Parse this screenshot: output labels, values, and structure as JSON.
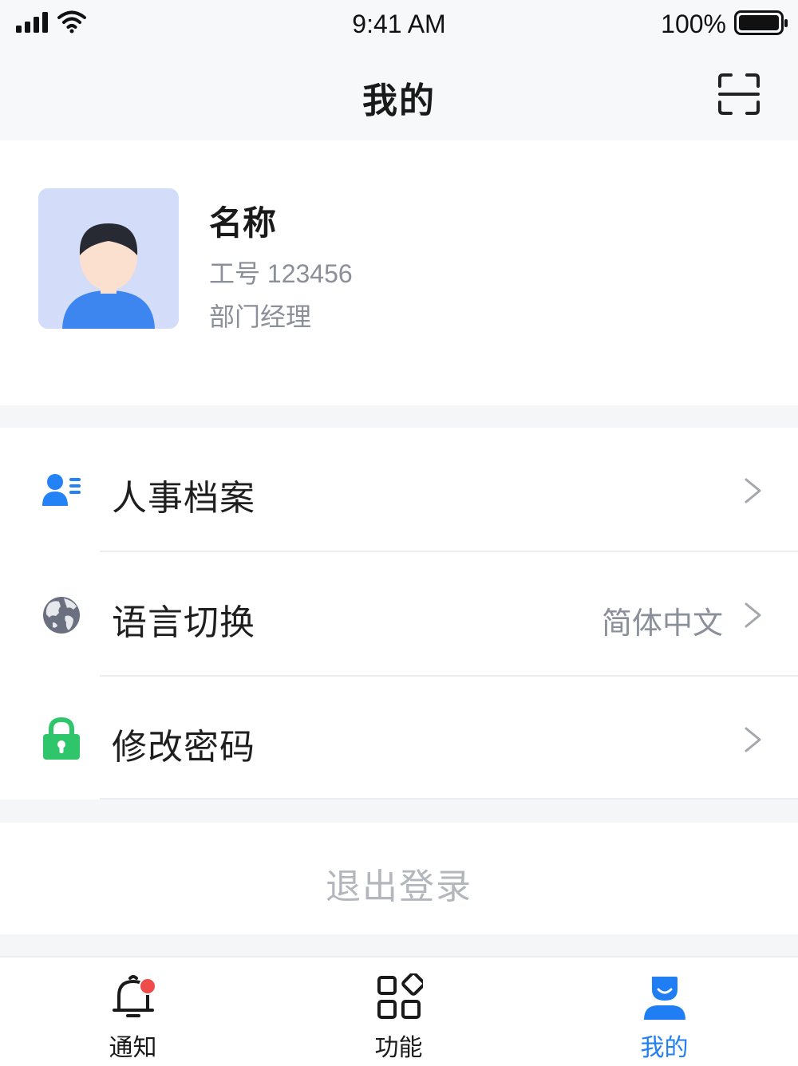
{
  "status_bar": {
    "time": "9:41 AM",
    "battery": "100%"
  },
  "header": {
    "title": "我的",
    "scan_icon": "scan-icon"
  },
  "profile": {
    "name": "名称",
    "employee_id": "工号 123456",
    "position": "部门经理"
  },
  "menu": {
    "items": [
      {
        "label": "人事档案",
        "icon": "personnel-file-icon",
        "value": ""
      },
      {
        "label": "语言切换",
        "icon": "globe-icon",
        "value": "简体中文"
      },
      {
        "label": "修改密码",
        "icon": "lock-icon",
        "value": ""
      }
    ]
  },
  "logout": {
    "label": "退出登录"
  },
  "tabs": [
    {
      "label": "通知",
      "icon": "bell-icon",
      "badge": true
    },
    {
      "label": "功能",
      "icon": "grid-icon",
      "badge": false
    },
    {
      "label": "我的",
      "icon": "user-icon",
      "active": true
    }
  ],
  "colors": {
    "accent": "#1f7ef3",
    "badge": "#f04b4b",
    "lock": "#2fc56b",
    "avatar_bg": "#d3ddf9",
    "secondary_text": "#8a8f99"
  }
}
